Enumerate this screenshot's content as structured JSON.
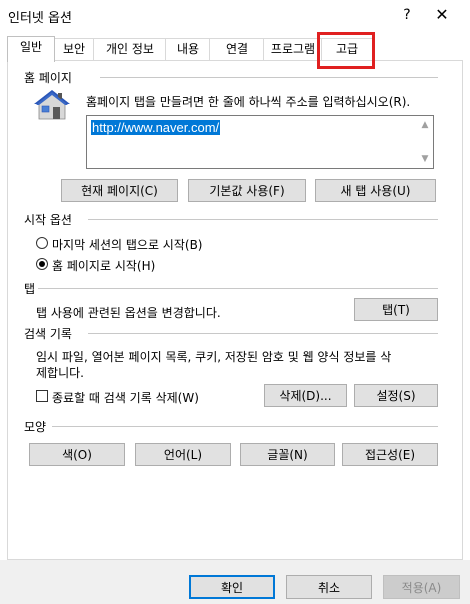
{
  "window": {
    "title": "인터넷 옵션",
    "help_glyph": "?",
    "close_glyph": "✕"
  },
  "tabs": [
    {
      "label": "일반",
      "active": true
    },
    {
      "label": "보안"
    },
    {
      "label": "개인 정보"
    },
    {
      "label": "내용"
    },
    {
      "label": "연결"
    },
    {
      "label": "프로그램"
    },
    {
      "label": "고급"
    }
  ],
  "home": {
    "section_label": "홈 페이지",
    "instruction": "홈페이지 탭을 만들려면 한 줄에 하나씩 주소를 입력하십시오(R).",
    "url": "http://www.naver.com/",
    "buttons": {
      "current": "현재 페이지(C)",
      "default": "기본값 사용(F)",
      "new_tab": "새 탭 사용(U)"
    },
    "icon": "house-icon"
  },
  "startup": {
    "section_label": "시작 옵션",
    "opt_last": "마지막 세션의 탭으로 시작(B)",
    "opt_home": "홈 페이지로 시작(H)",
    "selected": "home"
  },
  "tabs_section": {
    "section_label": "탭",
    "description": "탭 사용에 관련된 옵션을 변경합니다.",
    "button": "탭(T)"
  },
  "history": {
    "section_label": "검색 기록",
    "description_line1": "임시 파일, 열어본 페이지 목록, 쿠키, 저장된 암호 및 웹 양식 정보를 삭",
    "description_line2": "제합니다.",
    "checkbox_label": "종료할 때 검색 기록 삭제(W)",
    "delete_button": "삭제(D)...",
    "settings_button": "설정(S)"
  },
  "appearance": {
    "section_label": "모양",
    "colors": "색(O)",
    "languages": "언어(L)",
    "fonts": "글꼴(N)",
    "accessibility": "접근성(E)"
  },
  "footer": {
    "ok": "확인",
    "cancel": "취소",
    "apply": "적용(A)"
  },
  "colors": {
    "highlight": "#e02020",
    "selection": "#0078d7"
  }
}
